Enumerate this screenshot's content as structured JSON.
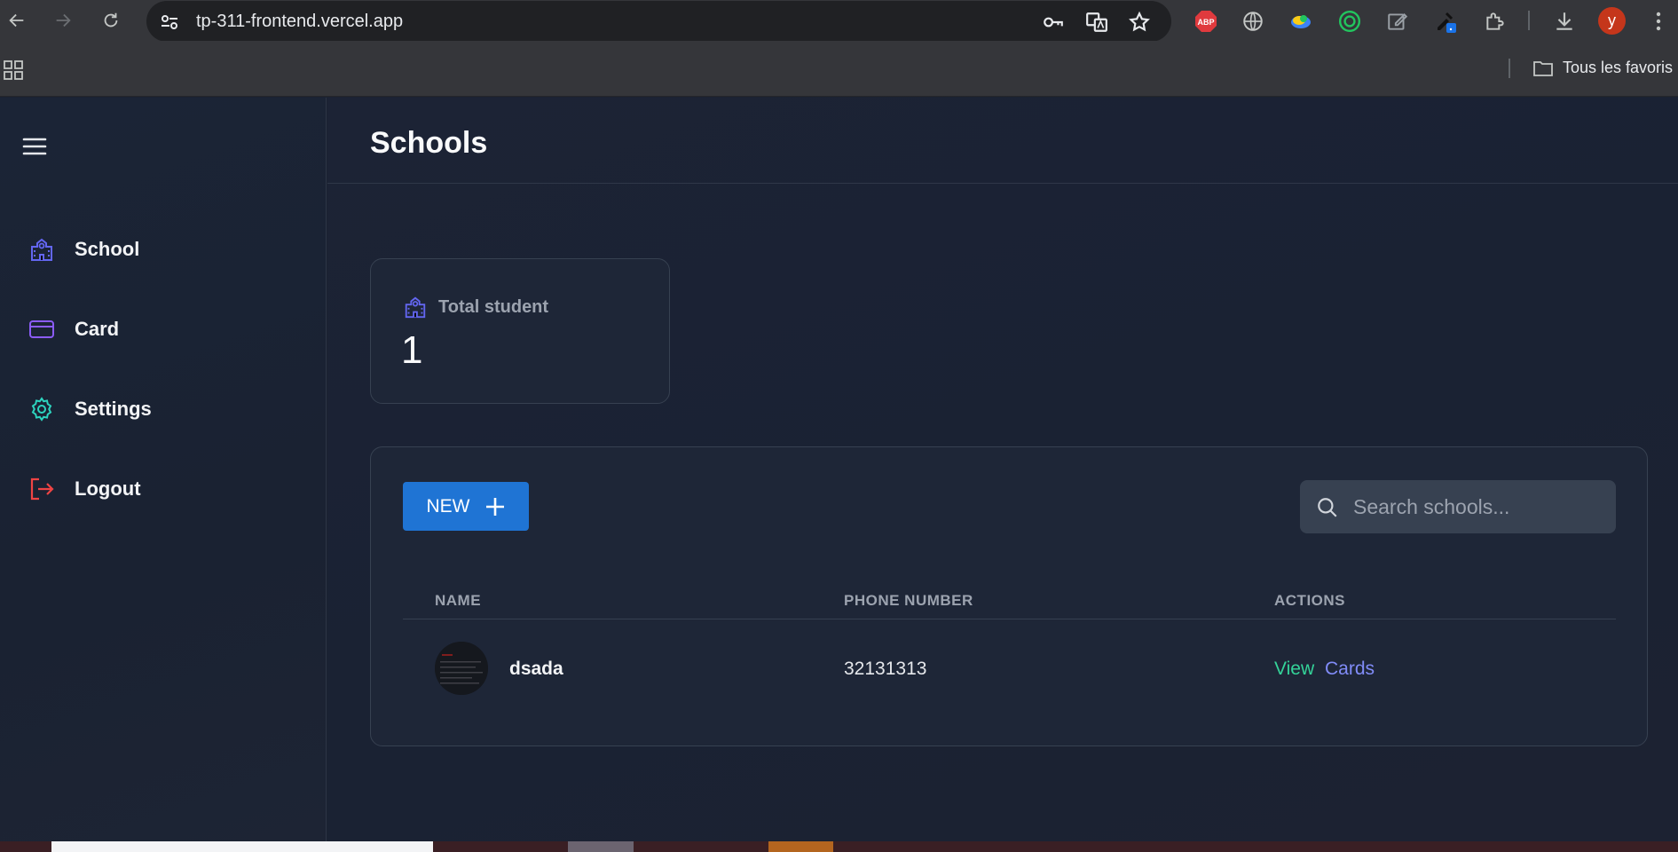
{
  "browser": {
    "url": "tp-311-frontend.vercel.app",
    "profile_initial": "y",
    "bookmark_folder": "Tous les favoris",
    "extensions": [
      "abp-icon",
      "globe-icon",
      "colorful-extension-icon",
      "target-extension-icon",
      "pencil-extension-icon",
      "picker-extension-icon",
      "puzzle-icon",
      "download-icon"
    ],
    "abp_label": "ABP"
  },
  "sidebar": {
    "items": [
      {
        "label": "School",
        "icon": "school-icon",
        "color": "#6366f1"
      },
      {
        "label": "Card",
        "icon": "credit-card-icon",
        "color": "#8b5cf6"
      },
      {
        "label": "Settings",
        "icon": "gear-icon",
        "color": "#2dd4bf"
      },
      {
        "label": "Logout",
        "icon": "logout-icon",
        "color": "#ef4444"
      }
    ]
  },
  "page": {
    "title": "Schools"
  },
  "stats": {
    "label": "Total student",
    "value": "1"
  },
  "toolbar": {
    "new_label": "NEW",
    "search_placeholder": "Search schools..."
  },
  "table": {
    "columns": [
      "NAME",
      "PHONE NUMBER",
      "ACTIONS"
    ],
    "rows": [
      {
        "name": "dsada",
        "phone": "32131313",
        "actions": [
          "View",
          "Cards"
        ]
      }
    ]
  },
  "colors": {
    "accent": "#1f74d4",
    "view_link": "#34d399",
    "cards_link": "#818cf8"
  }
}
